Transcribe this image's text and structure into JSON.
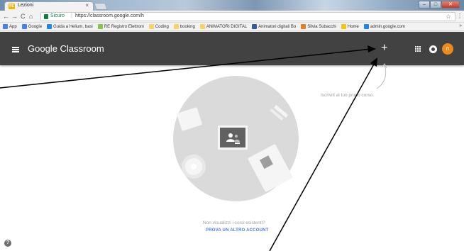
{
  "browser": {
    "tab_title": "Lezioni",
    "tab_favicon_text": "PE",
    "tab_close": "×",
    "nav_back": "←",
    "nav_forward": "→",
    "nav_reload": "C",
    "nav_home": "⌂",
    "secure_label": "Sicuro",
    "url": "https://classroom.google.com/h",
    "star": "☆",
    "window_controls": {
      "minimize": "–",
      "maximize": "□",
      "close": "✕"
    }
  },
  "bookmarks": {
    "items": [
      {
        "label": "App",
        "color": "#4c7df0"
      },
      {
        "label": "Google",
        "color": "#4285f4"
      },
      {
        "label": "Guida a Helium, basi",
        "color": "#1e88e5"
      },
      {
        "label": "RE Registro Elettroni",
        "color": "#8bc34a"
      },
      {
        "label": "Coding",
        "color": "#f6d365"
      },
      {
        "label": "booking",
        "color": "#f6d365"
      },
      {
        "label": "ANIMATORI DIGITAL",
        "color": "#f6d365"
      },
      {
        "label": "Animatori digitali Bo",
        "color": "#3b5998"
      },
      {
        "label": "Silvia Subacchi",
        "color": "#e67e22"
      },
      {
        "label": "Home",
        "color": "#f1c40f"
      },
      {
        "label": "admin.google.com",
        "color": "#1e88e5"
      }
    ],
    "more": "»"
  },
  "appbar": {
    "title": "Google Classroom",
    "plus_label": "+",
    "avatar_initial": "n",
    "colors": {
      "bar": "#424242",
      "avatar": "#ef8a1a"
    }
  },
  "main": {
    "hint": "Iscriviti al tuo primo corso.",
    "empty_text": "Non visualizzi i corsi esistenti?",
    "other_account_link": "PROVA UN ALTRO ACCOUNT",
    "help": "?"
  },
  "icons": [
    "hamburger-menu-icon",
    "plus-icon",
    "apps-grid-icon",
    "account-ring-icon",
    "help-icon",
    "lock-icon",
    "star-icon"
  ]
}
